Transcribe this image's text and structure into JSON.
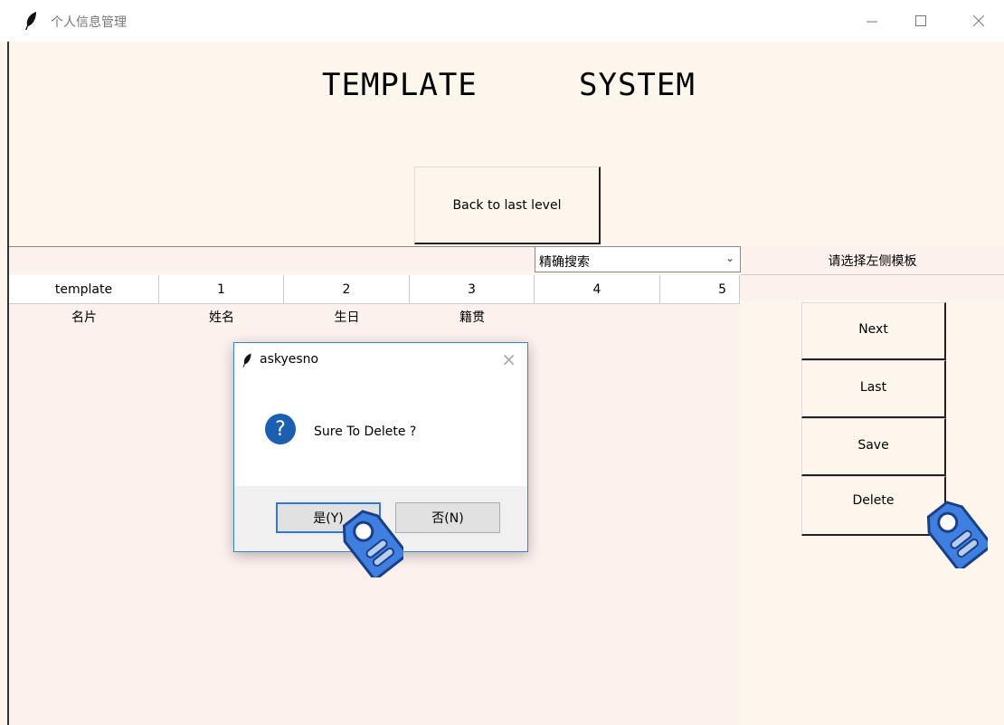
{
  "window": {
    "title": "个人信息管理"
  },
  "heading": {
    "word1": "TEMPLATE",
    "word2": "SYSTEM"
  },
  "back_button": "Back to last level",
  "search": {
    "mode": "精确搜索",
    "hint": "请选择左侧模板"
  },
  "table": {
    "headers": [
      "template",
      "1",
      "2",
      "3",
      "4",
      "5"
    ],
    "rows": [
      [
        "名片",
        "姓名",
        "生日",
        "籍贯",
        "",
        ""
      ]
    ]
  },
  "side_buttons": {
    "next": "Next",
    "last": "Last",
    "save": "Save",
    "delete": "Delete"
  },
  "dialog": {
    "title": "askyesno",
    "message": "Sure To Delete ?",
    "yes": "是(Y)",
    "no": "否(N)"
  },
  "icons": {
    "app": "feather-icon",
    "dialog": "question-icon",
    "cursor": "tag-cursor-icon"
  },
  "colors": {
    "background": "#fdf6ec",
    "table_bg": "#fdf1ee",
    "accent": "#2b79d8",
    "question": "#1b5fb0"
  }
}
